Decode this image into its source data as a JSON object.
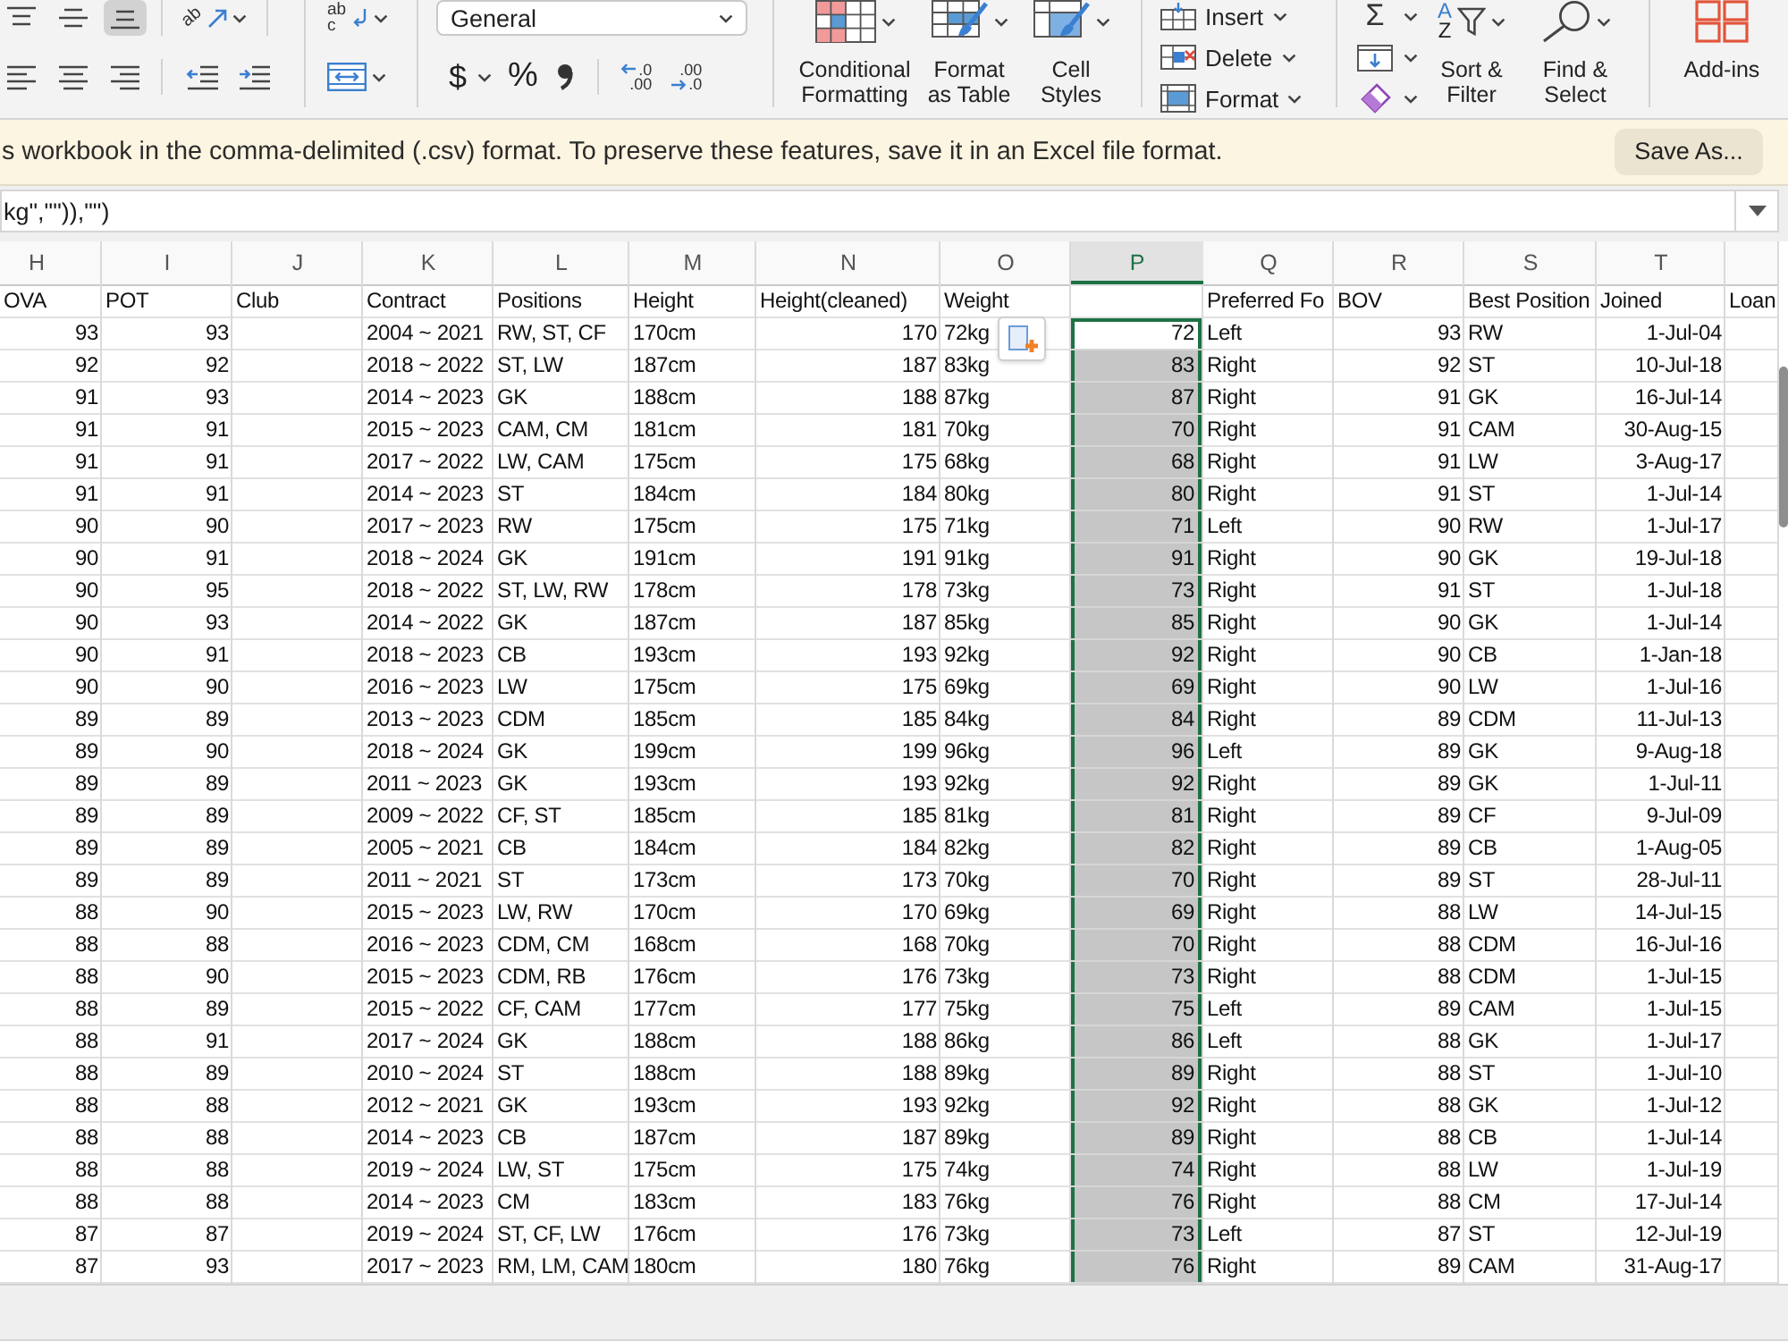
{
  "ribbon": {
    "alignment": {
      "vertical_align": [
        {
          "kind": "top",
          "selected": false
        },
        {
          "kind": "middle",
          "selected": false
        },
        {
          "kind": "bottom",
          "selected": true
        }
      ],
      "orientation": {
        "glyph": "ab"
      },
      "horizontal_align": [
        {
          "kind": "left"
        },
        {
          "kind": "center"
        },
        {
          "kind": "right"
        }
      ],
      "indent": [
        {
          "kind": "decrease"
        },
        {
          "kind": "increase"
        }
      ],
      "wrap_text": {
        "glyph_top": "ab",
        "glyph_bottom": "c"
      }
    },
    "number": {
      "format": "General",
      "currency": "$",
      "percent": "%",
      "decimals": [
        {
          "kind": "increase",
          "top": ".0",
          "bottom": ".00"
        },
        {
          "kind": "decrease",
          "top": ".00",
          "bottom": ".0"
        }
      ]
    },
    "styles": [
      {
        "kind": "conditional_formatting",
        "label": "Conditional Formatting"
      },
      {
        "kind": "format_as_table",
        "label": "Format as Table"
      },
      {
        "kind": "cell_styles",
        "label": "Cell Styles"
      }
    ],
    "cells": [
      {
        "kind": "insert",
        "label": "Insert"
      },
      {
        "kind": "delete",
        "label": "Delete"
      },
      {
        "kind": "format",
        "label": "Format"
      }
    ],
    "editing": {
      "tools": [
        {
          "kind": "autosum",
          "glyph": "Σ"
        },
        {
          "kind": "fill"
        },
        {
          "kind": "clear"
        }
      ],
      "sort_filter": {
        "label": "Sort & Filter",
        "letters": [
          "A",
          "Z"
        ]
      },
      "find_select": {
        "label": "Find & Select"
      }
    },
    "add_ins": {
      "label": "Add-ins"
    }
  },
  "message_bar": {
    "text": "s workbook in the comma-delimited (.csv) format. To preserve these features, save it in an Excel file format.",
    "button": "Save As..."
  },
  "formula_bar": {
    "value": "kg\",\"\")),\"\")"
  },
  "sheet": {
    "columns": [
      {
        "letter": "H",
        "selected": false
      },
      {
        "letter": "I",
        "selected": false
      },
      {
        "letter": "J",
        "selected": false
      },
      {
        "letter": "K",
        "selected": false
      },
      {
        "letter": "L",
        "selected": false
      },
      {
        "letter": "M",
        "selected": false
      },
      {
        "letter": "N",
        "selected": false
      },
      {
        "letter": "O",
        "selected": false
      },
      {
        "letter": "P",
        "selected": true
      },
      {
        "letter": "Q",
        "selected": false
      },
      {
        "letter": "R",
        "selected": false
      },
      {
        "letter": "S",
        "selected": false
      },
      {
        "letter": "T",
        "selected": false
      }
    ],
    "header_row": {
      "ova": "OVA",
      "pot": "POT",
      "club": "Club",
      "contract": "Contract",
      "positions": "Positions",
      "height": "Height",
      "height_cleaned": "Height(cleaned)",
      "weight": "Weight",
      "preferred_foot": "Preferred Fo",
      "bov": "BOV",
      "best_position": "Best Position",
      "joined": "Joined",
      "loan": "Loan"
    },
    "rows": [
      {
        "ova": "93",
        "pot": "93",
        "contract": "2004 ~ 2021",
        "positions": "RW, ST, CF",
        "height": "170cm",
        "height_cleaned": "170",
        "weight": "72kg",
        "column_p": {
          "value": "72",
          "selected": true,
          "active": true
        },
        "preferred_foot": "Left",
        "bov": "93",
        "best_position": "RW",
        "joined": "1-Jul-04"
      },
      {
        "ova": "92",
        "pot": "92",
        "contract": "2018 ~ 2022",
        "positions": "ST, LW",
        "height": "187cm",
        "height_cleaned": "187",
        "weight": "83kg",
        "column_p": {
          "value": "83",
          "selected": true,
          "active": false
        },
        "preferred_foot": "Right",
        "bov": "92",
        "best_position": "ST",
        "joined": "10-Jul-18"
      },
      {
        "ova": "91",
        "pot": "93",
        "contract": "2014 ~ 2023",
        "positions": "GK",
        "height": "188cm",
        "height_cleaned": "188",
        "weight": "87kg",
        "column_p": {
          "value": "87",
          "selected": true,
          "active": false
        },
        "preferred_foot": "Right",
        "bov": "91",
        "best_position": "GK",
        "joined": "16-Jul-14"
      },
      {
        "ova": "91",
        "pot": "91",
        "contract": "2015 ~ 2023",
        "positions": "CAM, CM",
        "height": "181cm",
        "height_cleaned": "181",
        "weight": "70kg",
        "column_p": {
          "value": "70",
          "selected": true,
          "active": false
        },
        "preferred_foot": "Right",
        "bov": "91",
        "best_position": "CAM",
        "joined": "30-Aug-15"
      },
      {
        "ova": "91",
        "pot": "91",
        "contract": "2017 ~ 2022",
        "positions": "LW, CAM",
        "height": "175cm",
        "height_cleaned": "175",
        "weight": "68kg",
        "column_p": {
          "value": "68",
          "selected": true,
          "active": false
        },
        "preferred_foot": "Right",
        "bov": "91",
        "best_position": "LW",
        "joined": "3-Aug-17"
      },
      {
        "ova": "91",
        "pot": "91",
        "contract": "2014 ~ 2023",
        "positions": "ST",
        "height": "184cm",
        "height_cleaned": "184",
        "weight": "80kg",
        "column_p": {
          "value": "80",
          "selected": true,
          "active": false
        },
        "preferred_foot": "Right",
        "bov": "91",
        "best_position": "ST",
        "joined": "1-Jul-14"
      },
      {
        "ova": "90",
        "pot": "90",
        "contract": "2017 ~ 2023",
        "positions": "RW",
        "height": "175cm",
        "height_cleaned": "175",
        "weight": "71kg",
        "column_p": {
          "value": "71",
          "selected": true,
          "active": false
        },
        "preferred_foot": "Left",
        "bov": "90",
        "best_position": "RW",
        "joined": "1-Jul-17"
      },
      {
        "ova": "90",
        "pot": "91",
        "contract": "2018 ~ 2024",
        "positions": "GK",
        "height": "191cm",
        "height_cleaned": "191",
        "weight": "91kg",
        "column_p": {
          "value": "91",
          "selected": true,
          "active": false
        },
        "preferred_foot": "Right",
        "bov": "90",
        "best_position": "GK",
        "joined": "19-Jul-18"
      },
      {
        "ova": "90",
        "pot": "95",
        "contract": "2018 ~ 2022",
        "positions": "ST, LW, RW",
        "height": "178cm",
        "height_cleaned": "178",
        "weight": "73kg",
        "column_p": {
          "value": "73",
          "selected": true,
          "active": false
        },
        "preferred_foot": "Right",
        "bov": "91",
        "best_position": "ST",
        "joined": "1-Jul-18"
      },
      {
        "ova": "90",
        "pot": "93",
        "contract": "2014 ~ 2022",
        "positions": "GK",
        "height": "187cm",
        "height_cleaned": "187",
        "weight": "85kg",
        "column_p": {
          "value": "85",
          "selected": true,
          "active": false
        },
        "preferred_foot": "Right",
        "bov": "90",
        "best_position": "GK",
        "joined": "1-Jul-14"
      },
      {
        "ova": "90",
        "pot": "91",
        "contract": "2018 ~ 2023",
        "positions": "CB",
        "height": "193cm",
        "height_cleaned": "193",
        "weight": "92kg",
        "column_p": {
          "value": "92",
          "selected": true,
          "active": false
        },
        "preferred_foot": "Right",
        "bov": "90",
        "best_position": "CB",
        "joined": "1-Jan-18"
      },
      {
        "ova": "90",
        "pot": "90",
        "contract": "2016 ~ 2023",
        "positions": "LW",
        "height": "175cm",
        "height_cleaned": "175",
        "weight": "69kg",
        "column_p": {
          "value": "69",
          "selected": true,
          "active": false
        },
        "preferred_foot": "Right",
        "bov": "90",
        "best_position": "LW",
        "joined": "1-Jul-16"
      },
      {
        "ova": "89",
        "pot": "89",
        "contract": "2013 ~ 2023",
        "positions": "CDM",
        "height": "185cm",
        "height_cleaned": "185",
        "weight": "84kg",
        "column_p": {
          "value": "84",
          "selected": true,
          "active": false
        },
        "preferred_foot": "Right",
        "bov": "89",
        "best_position": "CDM",
        "joined": "11-Jul-13"
      },
      {
        "ova": "89",
        "pot": "90",
        "contract": "2018 ~ 2024",
        "positions": "GK",
        "height": "199cm",
        "height_cleaned": "199",
        "weight": "96kg",
        "column_p": {
          "value": "96",
          "selected": true,
          "active": false
        },
        "preferred_foot": "Left",
        "bov": "89",
        "best_position": "GK",
        "joined": "9-Aug-18"
      },
      {
        "ova": "89",
        "pot": "89",
        "contract": "2011 ~ 2023",
        "positions": "GK",
        "height": "193cm",
        "height_cleaned": "193",
        "weight": "92kg",
        "column_p": {
          "value": "92",
          "selected": true,
          "active": false
        },
        "preferred_foot": "Right",
        "bov": "89",
        "best_position": "GK",
        "joined": "1-Jul-11"
      },
      {
        "ova": "89",
        "pot": "89",
        "contract": "2009 ~ 2022",
        "positions": "CF, ST",
        "height": "185cm",
        "height_cleaned": "185",
        "weight": "81kg",
        "column_p": {
          "value": "81",
          "selected": true,
          "active": false
        },
        "preferred_foot": "Right",
        "bov": "89",
        "best_position": "CF",
        "joined": "9-Jul-09"
      },
      {
        "ova": "89",
        "pot": "89",
        "contract": "2005 ~ 2021",
        "positions": "CB",
        "height": "184cm",
        "height_cleaned": "184",
        "weight": "82kg",
        "column_p": {
          "value": "82",
          "selected": true,
          "active": false
        },
        "preferred_foot": "Right",
        "bov": "89",
        "best_position": "CB",
        "joined": "1-Aug-05"
      },
      {
        "ova": "89",
        "pot": "89",
        "contract": "2011 ~ 2021",
        "positions": "ST",
        "height": "173cm",
        "height_cleaned": "173",
        "weight": "70kg",
        "column_p": {
          "value": "70",
          "selected": true,
          "active": false
        },
        "preferred_foot": "Right",
        "bov": "89",
        "best_position": "ST",
        "joined": "28-Jul-11"
      },
      {
        "ova": "88",
        "pot": "90",
        "contract": "2015 ~ 2023",
        "positions": "LW, RW",
        "height": "170cm",
        "height_cleaned": "170",
        "weight": "69kg",
        "column_p": {
          "value": "69",
          "selected": true,
          "active": false
        },
        "preferred_foot": "Right",
        "bov": "88",
        "best_position": "LW",
        "joined": "14-Jul-15"
      },
      {
        "ova": "88",
        "pot": "88",
        "contract": "2016 ~ 2023",
        "positions": "CDM, CM",
        "height": "168cm",
        "height_cleaned": "168",
        "weight": "70kg",
        "column_p": {
          "value": "70",
          "selected": true,
          "active": false
        },
        "preferred_foot": "Right",
        "bov": "88",
        "best_position": "CDM",
        "joined": "16-Jul-16"
      },
      {
        "ova": "88",
        "pot": "90",
        "contract": "2015 ~ 2023",
        "positions": "CDM, RB",
        "height": "176cm",
        "height_cleaned": "176",
        "weight": "73kg",
        "column_p": {
          "value": "73",
          "selected": true,
          "active": false
        },
        "preferred_foot": "Right",
        "bov": "88",
        "best_position": "CDM",
        "joined": "1-Jul-15"
      },
      {
        "ova": "88",
        "pot": "89",
        "contract": "2015 ~ 2022",
        "positions": "CF, CAM",
        "height": "177cm",
        "height_cleaned": "177",
        "weight": "75kg",
        "column_p": {
          "value": "75",
          "selected": true,
          "active": false
        },
        "preferred_foot": "Left",
        "bov": "89",
        "best_position": "CAM",
        "joined": "1-Jul-15"
      },
      {
        "ova": "88",
        "pot": "91",
        "contract": "2017 ~ 2024",
        "positions": "GK",
        "height": "188cm",
        "height_cleaned": "188",
        "weight": "86kg",
        "column_p": {
          "value": "86",
          "selected": true,
          "active": false
        },
        "preferred_foot": "Left",
        "bov": "88",
        "best_position": "GK",
        "joined": "1-Jul-17"
      },
      {
        "ova": "88",
        "pot": "89",
        "contract": "2010 ~ 2024",
        "positions": "ST",
        "height": "188cm",
        "height_cleaned": "188",
        "weight": "89kg",
        "column_p": {
          "value": "89",
          "selected": true,
          "active": false
        },
        "preferred_foot": "Right",
        "bov": "88",
        "best_position": "ST",
        "joined": "1-Jul-10"
      },
      {
        "ova": "88",
        "pot": "88",
        "contract": "2012 ~ 2021",
        "positions": "GK",
        "height": "193cm",
        "height_cleaned": "193",
        "weight": "92kg",
        "column_p": {
          "value": "92",
          "selected": true,
          "active": false
        },
        "preferred_foot": "Right",
        "bov": "88",
        "best_position": "GK",
        "joined": "1-Jul-12"
      },
      {
        "ova": "88",
        "pot": "88",
        "contract": "2014 ~ 2023",
        "positions": "CB",
        "height": "187cm",
        "height_cleaned": "187",
        "weight": "89kg",
        "column_p": {
          "value": "89",
          "selected": true,
          "active": false
        },
        "preferred_foot": "Right",
        "bov": "88",
        "best_position": "CB",
        "joined": "1-Jul-14"
      },
      {
        "ova": "88",
        "pot": "88",
        "contract": "2019 ~ 2024",
        "positions": "LW, ST",
        "height": "175cm",
        "height_cleaned": "175",
        "weight": "74kg",
        "column_p": {
          "value": "74",
          "selected": true,
          "active": false
        },
        "preferred_foot": "Right",
        "bov": "88",
        "best_position": "LW",
        "joined": "1-Jul-19"
      },
      {
        "ova": "88",
        "pot": "88",
        "contract": "2014 ~ 2023",
        "positions": "CM",
        "height": "183cm",
        "height_cleaned": "183",
        "weight": "76kg",
        "column_p": {
          "value": "76",
          "selected": true,
          "active": false
        },
        "preferred_foot": "Right",
        "bov": "88",
        "best_position": "CM",
        "joined": "17-Jul-14"
      },
      {
        "ova": "87",
        "pot": "87",
        "contract": "2019 ~ 2024",
        "positions": "ST, CF, LW",
        "height": "176cm",
        "height_cleaned": "176",
        "weight": "73kg",
        "column_p": {
          "value": "73",
          "selected": true,
          "active": false
        },
        "preferred_foot": "Left",
        "bov": "87",
        "best_position": "ST",
        "joined": "12-Jul-19"
      },
      {
        "ova": "87",
        "pot": "93",
        "contract": "2017 ~ 2023",
        "positions": "RM, LM, CAM",
        "height": "180cm",
        "height_cleaned": "180",
        "weight": "76kg",
        "column_p": {
          "value": "76",
          "selected": true,
          "active": false
        },
        "preferred_foot": "Right",
        "bov": "89",
        "best_position": "CAM",
        "joined": "31-Aug-17"
      }
    ]
  }
}
